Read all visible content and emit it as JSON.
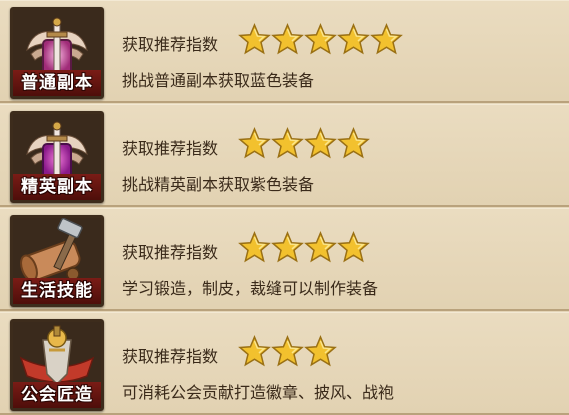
{
  "dungeon_list": {
    "items": [
      {
        "icon": "pink-sword-shield-icon",
        "name": "普通副本",
        "recommend_label": "获取推荐指数",
        "rating": 5,
        "description": "挑战普通副本获取蓝色装备"
      },
      {
        "icon": "purple-sword-shield-icon",
        "name": "精英副本",
        "recommend_label": "获取推荐指数",
        "rating": 4,
        "description": "挑战精英副本获取紫色装备"
      },
      {
        "icon": "hammer-scroll-icon",
        "name": "生活技能",
        "recommend_label": "获取推荐指数",
        "rating": 4,
        "description": "学习锻造，制皮，裁缝可以制作装备"
      },
      {
        "icon": "guild-emblem-icon",
        "name": "公会匠造",
        "recommend_label": "获取推荐指数",
        "rating": 3,
        "description": "可消耗公会贡献打造徽章、披风、战袍"
      }
    ]
  },
  "colors": {
    "star": "#f2c12e",
    "label_bg": "#6a1812",
    "text": "#3a2a1a"
  }
}
